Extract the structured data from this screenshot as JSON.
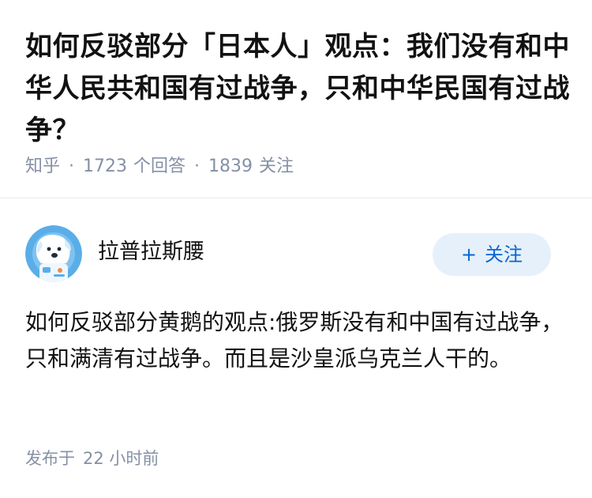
{
  "question": {
    "title": "如何反驳部分「日本人」观点：我们没有和中华人民共和国有过战争，只和中华民国有过战争？",
    "source": "知乎",
    "separator": "·",
    "answers_count": "1723",
    "answers_label": "个回答",
    "followers_count": "1839",
    "followers_label": "关注"
  },
  "answer": {
    "author": {
      "name": "拉普拉斯腰",
      "avatar_icon": "astronaut-dog-avatar-icon"
    },
    "follow_button": {
      "icon": "+",
      "label": "关注"
    },
    "content": "如何反驳部分黄鹅的观点:俄罗斯没有和中国有过战争，只和满清有过战争。而且是沙皇派乌克兰人干的。",
    "publish_label": "发布于",
    "publish_time": "22 小时前"
  },
  "colors": {
    "title": "#121212",
    "meta": "#8590a6",
    "follow_bg": "#e5f0fb",
    "follow_text": "#0a66d1",
    "avatar_bg": "#5aaee8",
    "divider": "#ebebeb"
  }
}
